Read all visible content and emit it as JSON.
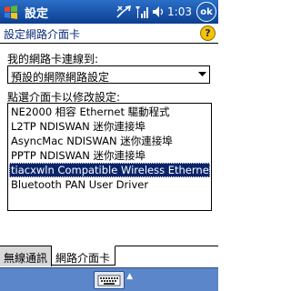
{
  "window": {
    "title": "設定",
    "time": "1:03",
    "ok_label": "ok"
  },
  "header": {
    "title": "設定網路介面卡"
  },
  "form": {
    "connect_label": "我的網路卡連線到:",
    "connect_value": "預設的網際網路設定",
    "adapter_label": "點選介面卡以修改設定:"
  },
  "adapters": [
    {
      "label": "NE2000 相容 Ethernet 驅動程式",
      "selected": false
    },
    {
      "label": "L2TP NDISWAN 迷你連接埠",
      "selected": false
    },
    {
      "label": "AsyncMac NDISWAN 迷你連接埠",
      "selected": false
    },
    {
      "label": "PPTP NDISWAN 迷你連接埠",
      "selected": false
    },
    {
      "label": "tiacxwln Compatible Wireless Ethernet",
      "selected": true
    },
    {
      "label": "Bluetooth PAN User Driver",
      "selected": false
    }
  ],
  "tabs": [
    {
      "label": "無線通訊",
      "active": false
    },
    {
      "label": "網路介面卡",
      "active": true
    }
  ],
  "colors": {
    "titlebar": "#0c3f8f",
    "selection": "#0a246a",
    "menubar": "#5b86c9"
  }
}
